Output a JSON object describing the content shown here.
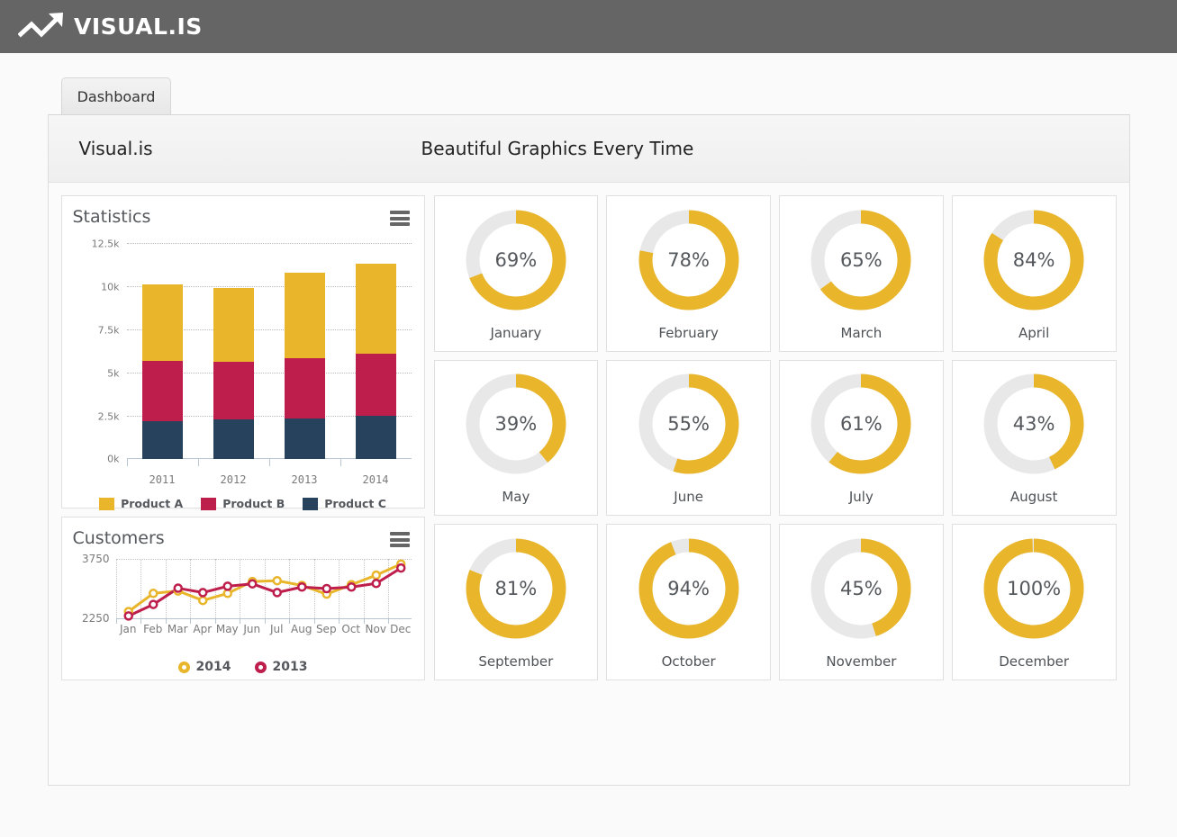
{
  "colors": {
    "topbar_bg": "#656565",
    "product_a": "#e8b52b",
    "product_b": "#be1e4c",
    "product_c": "#26425c",
    "gauge_fill": "#e8b52b",
    "gauge_track": "#e8e8e8",
    "series_2014": "#e8b52b",
    "series_2013": "#be1e4c"
  },
  "topbar": {
    "logo_icon": "line-chart-arrow-icon",
    "logo_text": "VISUAL.IS"
  },
  "tabs": [
    {
      "label": "Dashboard",
      "active": true
    }
  ],
  "panel_header": {
    "brand": "Visual.is",
    "tagline": "Beautiful Graphics Every Time"
  },
  "cards": {
    "statistics": {
      "title": "Statistics",
      "menu_icon": "hamburger-menu-icon"
    },
    "customers": {
      "title": "Customers",
      "menu_icon": "hamburger-menu-icon"
    }
  },
  "chart_data": [
    {
      "id": "statistics",
      "type": "bar",
      "title": "Statistics",
      "stacked": true,
      "categories": [
        "2011",
        "2012",
        "2013",
        "2014"
      ],
      "series": [
        {
          "name": "Product C",
          "color": "#26425c",
          "values": [
            2200,
            2300,
            2350,
            2500
          ]
        },
        {
          "name": "Product B",
          "color": "#be1e4c",
          "values": [
            3500,
            3350,
            3500,
            3600
          ]
        },
        {
          "name": "Product A",
          "color": "#e8b52b",
          "values": [
            4400,
            4250,
            4950,
            5200
          ]
        }
      ],
      "totals": [
        10100,
        9900,
        10800,
        11300
      ],
      "xlabel": "",
      "ylabel": "",
      "ylim": [
        0,
        12500
      ],
      "yticks": [
        0,
        2500,
        5000,
        7500,
        10000,
        12500
      ],
      "ytick_labels": [
        "0k",
        "2.5k",
        "5k",
        "7.5k",
        "10k",
        "12.5k"
      ],
      "grid": true,
      "legend_position": "bottom",
      "legend": [
        "Product A",
        "Product B",
        "Product C"
      ]
    },
    {
      "id": "customers",
      "type": "line",
      "title": "Customers",
      "categories": [
        "Jan",
        "Feb",
        "Mar",
        "Apr",
        "May",
        "Jun",
        "Jul",
        "Aug",
        "Sep",
        "Oct",
        "Nov",
        "Dec"
      ],
      "series": [
        {
          "name": "2014",
          "color": "#e8b52b",
          "values": [
            2420,
            2880,
            2940,
            2700,
            2880,
            3180,
            3200,
            3080,
            2860,
            3100,
            3340,
            3620
          ]
        },
        {
          "name": "2013",
          "color": "#be1e4c",
          "values": [
            2310,
            2600,
            3010,
            2900,
            3060,
            3120,
            2900,
            3040,
            3000,
            3040,
            3130,
            3520
          ]
        }
      ],
      "ylim": [
        2250,
        3750
      ],
      "yticks": [
        2250,
        3750
      ],
      "ytick_labels": [
        "2250",
        "3750"
      ],
      "grid": true,
      "legend_position": "bottom",
      "legend": [
        "2014",
        "2013"
      ]
    },
    {
      "id": "monthly-gauges",
      "type": "pie",
      "title": "Monthly completion gauges",
      "variant": "donut-gauge",
      "categories": [
        "January",
        "February",
        "March",
        "April",
        "May",
        "June",
        "July",
        "August",
        "September",
        "October",
        "November",
        "December"
      ],
      "values": [
        69,
        78,
        65,
        84,
        39,
        55,
        61,
        43,
        81,
        94,
        45,
        100
      ],
      "unit": "%",
      "max": 100
    }
  ],
  "gauges": [
    {
      "label": "January",
      "value": 69,
      "display": "69%"
    },
    {
      "label": "February",
      "value": 78,
      "display": "78%"
    },
    {
      "label": "March",
      "value": 65,
      "display": "65%"
    },
    {
      "label": "April",
      "value": 84,
      "display": "84%"
    },
    {
      "label": "May",
      "value": 39,
      "display": "39%"
    },
    {
      "label": "June",
      "value": 55,
      "display": "55%"
    },
    {
      "label": "July",
      "value": 61,
      "display": "61%"
    },
    {
      "label": "August",
      "value": 43,
      "display": "43%"
    },
    {
      "label": "September",
      "value": 81,
      "display": "81%"
    },
    {
      "label": "October",
      "value": 94,
      "display": "94%"
    },
    {
      "label": "November",
      "value": 45,
      "display": "45%"
    },
    {
      "label": "December",
      "value": 100,
      "display": "100%"
    }
  ]
}
